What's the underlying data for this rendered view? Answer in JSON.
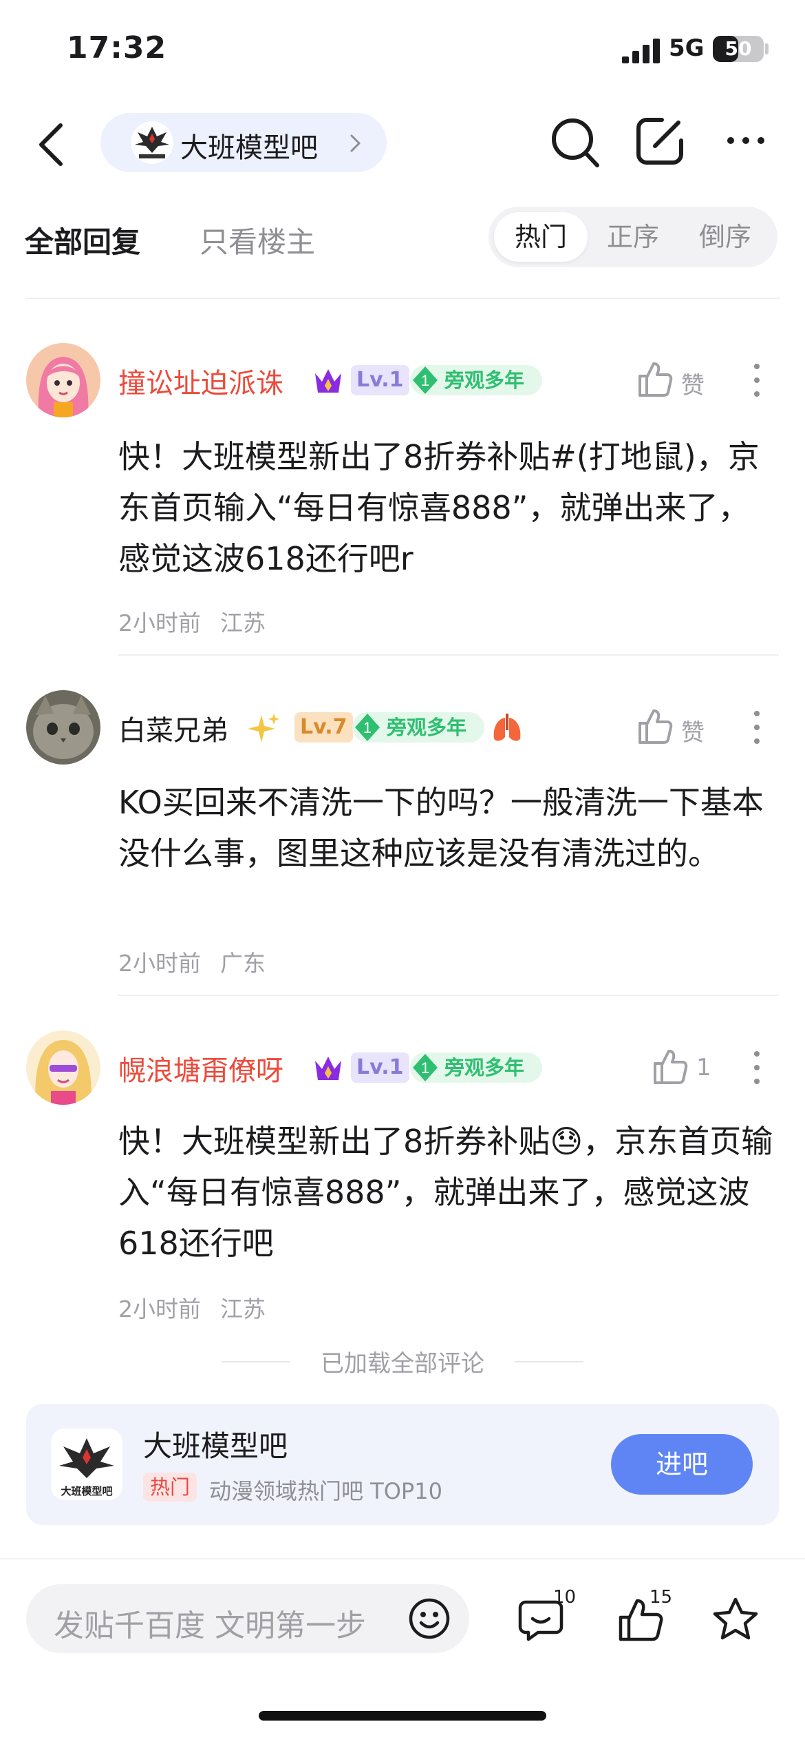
{
  "status_bar": {
    "time": "17:32",
    "network": "5G",
    "battery": "50",
    "battery_level": 0.5
  },
  "nav": {
    "forum_name": "大班模型吧",
    "logo_text": "大班模型吧"
  },
  "tabs": {
    "all_replies": "全部回复",
    "only_op": "只看楼主",
    "sort_options": [
      "热门",
      "正序",
      "倒序"
    ],
    "active_sort": "热门"
  },
  "comments": [
    {
      "username": "撞讼址迫派诛",
      "level": "Lv.1",
      "tag_num": "1",
      "tag_text": "旁观多年",
      "like_label": "赞",
      "content": "快！大班模型新出了8折券补贴#(打地鼠)，京东首页输入“每日有惊喜888”，就弹出来了，感觉这波618还行吧r",
      "time": "2小时前",
      "location": "江苏"
    },
    {
      "username": "白菜兄弟",
      "level": "Lv.7",
      "tag_num": "1",
      "tag_text": "旁观多年",
      "like_label": "赞",
      "content": "KO买回来不清洗一下的吗？一般清洗一下基本没什么事，图里这种应该是没有清洗过的。",
      "time": "2小时前",
      "location": "广东"
    },
    {
      "username": "幌浪塘甭僚呀",
      "level": "Lv.1",
      "tag_num": "1",
      "tag_text": "旁观多年",
      "like_label": "1",
      "content": "快！大班模型新出了8折券补贴😓，京东首页输入“每日有惊喜888”，就弹出来了，感觉这波618还行吧",
      "time": "2小时前",
      "location": "江苏"
    }
  ],
  "loaded_all": "已加载全部评论",
  "forum_card": {
    "name": "大班模型吧",
    "logo_text": "大班模型吧",
    "hot_tag": "热门",
    "rank": "动漫领域热门吧 TOP10",
    "join_label": "进吧"
  },
  "bottom_bar": {
    "placeholder": "发贴千百度 文明第一步",
    "comment_count": "10",
    "like_count": "15"
  },
  "icons": [
    "back-icon",
    "search-icon",
    "compose-icon",
    "more-icon",
    "crown-icon",
    "sparkle-icon",
    "lungs-icon",
    "thumbs-up-icon",
    "kebab-icon",
    "emoji-icon",
    "comment-icon",
    "star-icon"
  ],
  "colors": {
    "accent": "#5f85f4",
    "username_red": "#ec4b3b",
    "tag_green": "#2fbf71",
    "hot_red": "#e9473f"
  }
}
